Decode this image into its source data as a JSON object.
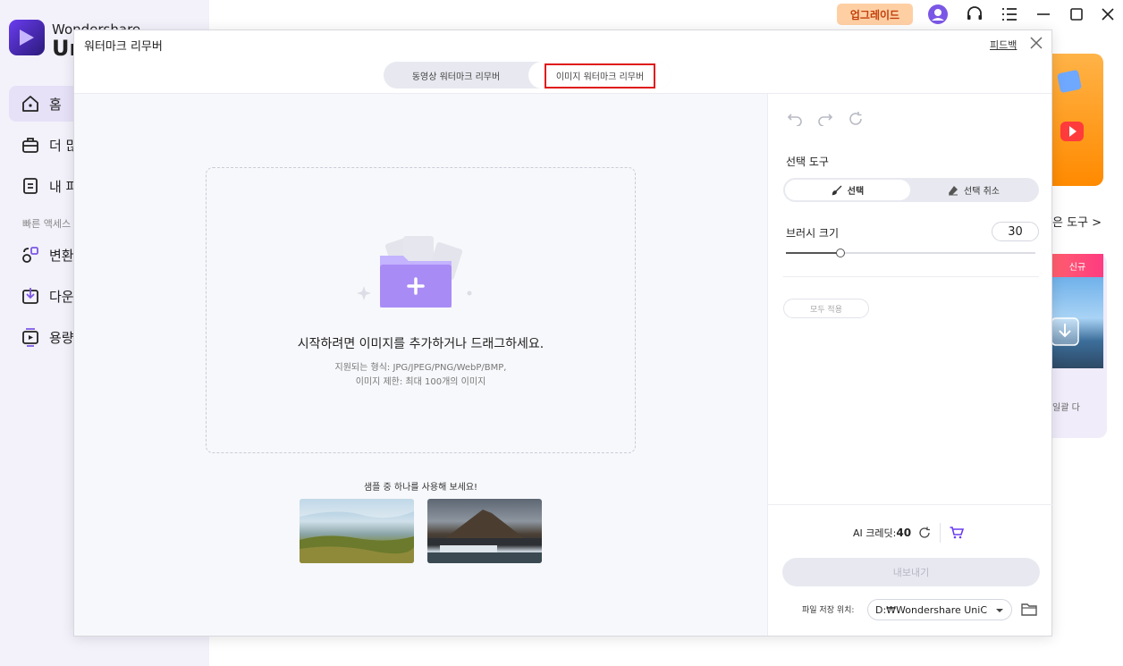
{
  "app": {
    "brand_line1": "Wondershare",
    "brand_line2": "Uni",
    "nav": [
      {
        "label": "홈",
        "icon": "home-icon"
      },
      {
        "label": "더 많",
        "icon": "toolbox-icon"
      },
      {
        "label": "내 파",
        "icon": "file-icon"
      }
    ],
    "quick_access_label": "빠른 액세스",
    "quick": [
      {
        "label": "변환",
        "icon": "convert-icon"
      },
      {
        "label": "다운",
        "icon": "download-icon"
      },
      {
        "label": "용량",
        "icon": "compress-icon"
      }
    ],
    "upgrade_label": "업그레이드",
    "more_tools_label": "은 도구 >",
    "promo_new_badge": "신규",
    "promo_text": "일괄 다"
  },
  "dialog": {
    "title": "워터마크 리무버",
    "feedback_label": "피드백",
    "tabs": [
      {
        "label": "동영상 워터마크 리무버",
        "active": false
      },
      {
        "label": "이미지 워터마크 리무버",
        "active": true
      }
    ],
    "dropzone": {
      "main_text": "시작하려면 이미지를 추가하거나 드래그하세요.",
      "formats_text": "지원되는 형식: JPG/JPEG/PNG/WebP/BMP,",
      "limit_text": "이미지 제한: 최대 100개의 이미지"
    },
    "sample_label": "샘플 중 하나를 사용해 보세요!",
    "samples": [
      {
        "alt": "grassland-sample"
      },
      {
        "alt": "mountain-waterfall-sample"
      }
    ],
    "panel": {
      "select_tool_label": "선택 도구",
      "select_label": "선택",
      "deselect_label": "선택 취소",
      "brush_size_label": "브러시 크기",
      "brush_size_value": "30",
      "brush_slider_fraction": 0.22,
      "apply_all_label": "모두 적용",
      "credit_prefix": "AI 크레딧:",
      "credit_value": "40",
      "export_label": "내보내기",
      "save_location_label": "파일 저장 위치:",
      "save_location_value": "D:₩Wondershare UniConverter"
    }
  },
  "colors": {
    "accent": "#7b57e6",
    "highlight_box": "#e01818",
    "upgrade_bg": "#ffcfa4"
  }
}
